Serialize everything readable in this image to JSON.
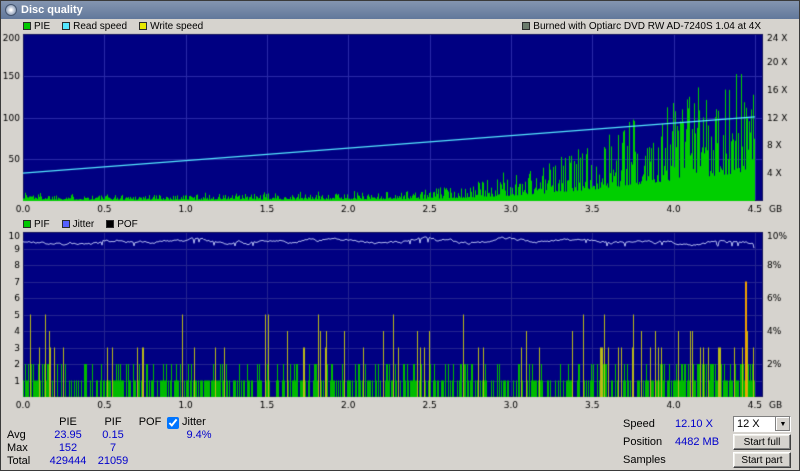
{
  "window": {
    "title": "Disc quality"
  },
  "chart_data": [
    {
      "id": "pie",
      "type": "bar",
      "legend": [
        {
          "label": "PIE",
          "color": "#00c800"
        },
        {
          "label": "Read speed",
          "color": "#55e8ff"
        },
        {
          "label": "Write speed",
          "color": "#e8e800"
        }
      ],
      "annotation": {
        "label": "Burned with Optiarc DVD RW AD-7240S 1.04 at 4X",
        "color": "#6b7b6b"
      },
      "bg": "#000082",
      "grid_color": "#2a2aa8",
      "x_axis": {
        "ticks": [
          0,
          0.5,
          1,
          1.5,
          2,
          2.5,
          3,
          3.5,
          4,
          4.5
        ],
        "max": 4.55,
        "data_end": 4.5,
        "unit": "GB"
      },
      "y_left": {
        "max": 200,
        "grid": [
          50,
          100,
          150
        ],
        "labels": [
          50,
          100,
          150,
          200
        ]
      },
      "y_right": {
        "max": 24,
        "labels": [
          4,
          8,
          12,
          16,
          20,
          24
        ],
        "suffix": " X"
      },
      "pie_series": {
        "color": "#00cf00",
        "max": 152,
        "envelope": [
          [
            0,
            12
          ],
          [
            0.15,
            8
          ],
          [
            0.5,
            7
          ],
          [
            1,
            7.5
          ],
          [
            1.5,
            8
          ],
          [
            2,
            9
          ],
          [
            2.4,
            11
          ],
          [
            2.7,
            17
          ],
          [
            3,
            28
          ],
          [
            3.2,
            40
          ],
          [
            3.5,
            62
          ],
          [
            3.8,
            92
          ],
          [
            4,
            112
          ],
          [
            4.2,
            133
          ],
          [
            4.38,
            149
          ],
          [
            4.47,
            143
          ],
          [
            4.5,
            70
          ]
        ]
      },
      "read_speed": {
        "color": "#55e8ff",
        "start": 4.0,
        "end": 12.1
      }
    },
    {
      "id": "pif",
      "type": "bar",
      "legend": [
        {
          "label": "PIF",
          "color": "#00c800"
        },
        {
          "label": "Jitter",
          "color": "#5560ff"
        },
        {
          "label": "POF",
          "color": "#000000"
        }
      ],
      "bg": "#000082",
      "grid_color": "#252590",
      "x_axis": {
        "ticks": [
          0,
          0.5,
          1,
          1.5,
          2,
          2.5,
          3,
          3.5,
          4,
          4.5
        ],
        "max": 4.55,
        "data_end": 4.5,
        "unit": "GB"
      },
      "y_left": {
        "max": 10,
        "grid": [
          1,
          2,
          3,
          4,
          5,
          6,
          7,
          8,
          9
        ],
        "labels": [
          1,
          2,
          3,
          4,
          5,
          6,
          7,
          8,
          9,
          10
        ]
      },
      "y_right": {
        "max": 10,
        "labels": [
          2,
          4,
          6,
          8,
          10
        ],
        "suffix": "%"
      },
      "pif_series": {
        "color_low": "#00bb00",
        "color_high": "#b9b919",
        "color_spike": "#f0a000",
        "density": 0.62,
        "dist": [
          [
            1,
            0.56
          ],
          [
            2,
            0.3
          ],
          [
            3,
            0.085
          ],
          [
            4,
            0.04
          ],
          [
            5,
            0.015
          ]
        ],
        "boost_from": 3.6,
        "spike": {
          "x": 4.44,
          "value": 7
        },
        "max": 7
      },
      "jitter": {
        "color": "#b4bcf0",
        "avg": 9.4
      }
    }
  ],
  "stats": {
    "headers": {
      "pie": "PIE",
      "pif": "PIF",
      "pof": "POF"
    },
    "jitter_label": "Jitter",
    "jitter_checked": true,
    "rows": [
      {
        "label": "Avg",
        "pie": "23.95",
        "pif": "0.15",
        "pof": "",
        "jitter": "9.4%"
      },
      {
        "label": "Max",
        "pie": "152",
        "pif": "7",
        "pof": "",
        "jitter": ""
      },
      {
        "label": "Total",
        "pie": "429444",
        "pif": "21059",
        "pof": "",
        "jitter": ""
      }
    ],
    "right": {
      "speed_label": "Speed",
      "speed_value": "12.10 X",
      "speed_option": "12 X",
      "position_label": "Position",
      "position_value": "4482 MB",
      "samples_label": "Samples",
      "samples_value": "",
      "start_full": "Start full",
      "start_part": "Start part"
    },
    "value_color": "#0000cc"
  }
}
